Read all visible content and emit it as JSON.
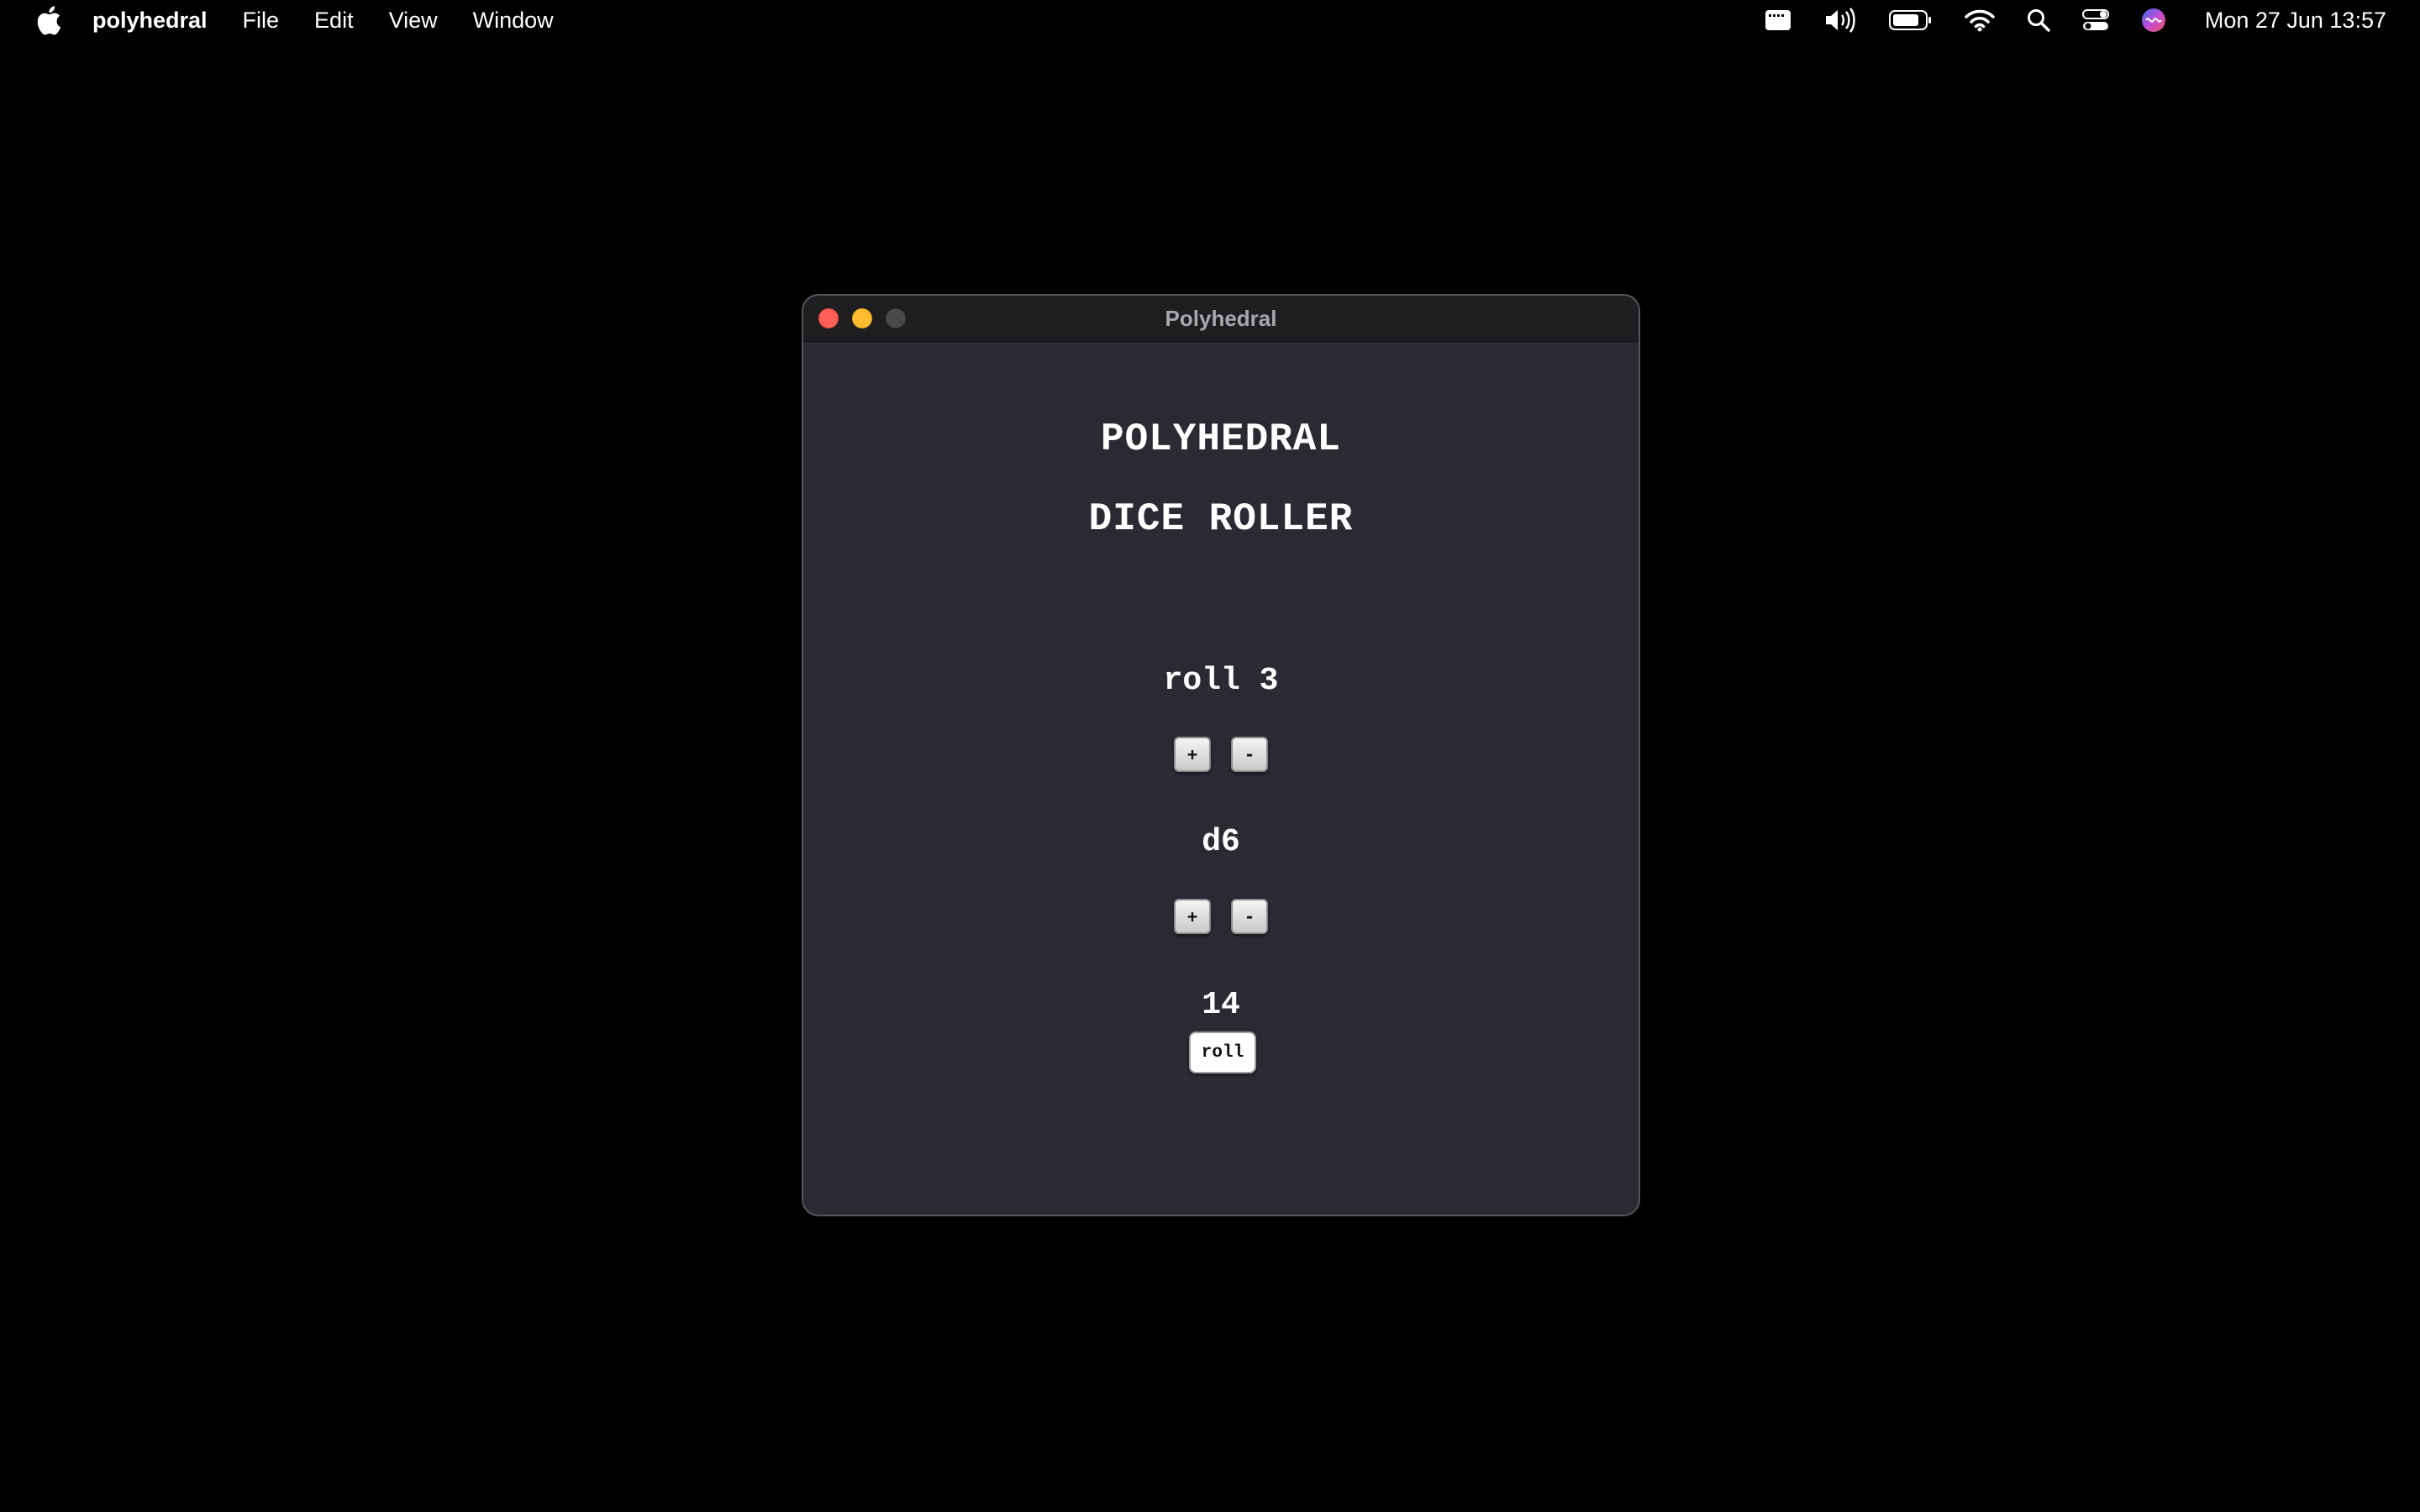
{
  "menubar": {
    "app_name": "polyhedral",
    "items": [
      "File",
      "Edit",
      "View",
      "Window"
    ],
    "clock": "Mon 27 Jun  13:57"
  },
  "window": {
    "title": "Polyhedral"
  },
  "app": {
    "heading_line1": "POLYHEDRAL",
    "heading_line2": "DICE ROLLER",
    "count_label": "roll 3",
    "die_label": "d6",
    "result": "14",
    "plus_label": "+",
    "minus_label": "-",
    "roll_label": "roll"
  },
  "colors": {
    "desktop": "#000000",
    "window_bg": "#2b2a33",
    "close": "#ff5f57",
    "minimize": "#febc2e"
  }
}
